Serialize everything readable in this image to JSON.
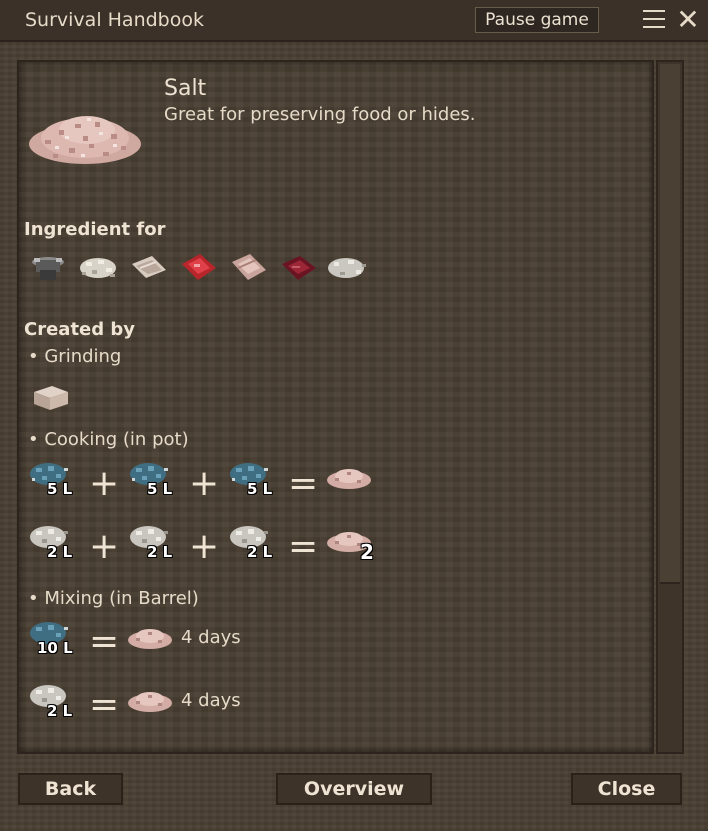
{
  "window": {
    "title": "Survival Handbook",
    "pause_label": "Pause game"
  },
  "item": {
    "name": "Salt",
    "description": "Great for preserving food or hides."
  },
  "ingredient_for": {
    "heading": "Ingredient for",
    "icons": [
      "horn-icon",
      "bone-pile-icon",
      "fish-fillet-icon",
      "raw-meat-icon",
      "pink-meat-icon",
      "red-meat-icon",
      "bone-flakes-icon"
    ]
  },
  "created_by": {
    "heading": "Created by",
    "grinding": {
      "label": "• Grinding",
      "icon": "salt-block-icon"
    },
    "cooking": {
      "label": "• Cooking (in pot)",
      "recipes": [
        {
          "inputs": [
            "5 L",
            "5 L",
            "5 L"
          ],
          "input_icon": "blue-liquid-icon",
          "plus": "+",
          "equals": "=",
          "output_qty": ""
        },
        {
          "inputs": [
            "2 L",
            "2 L",
            "2 L"
          ],
          "input_icon": "white-liquid-icon",
          "plus": "+",
          "equals": "=",
          "output_qty": "2"
        }
      ]
    },
    "mixing": {
      "label": "• Mixing (in Barrel)",
      "recipes": [
        {
          "input": "10 L",
          "input_icon": "blue-liquid-icon",
          "equals": "=",
          "duration": "4 days"
        },
        {
          "input": "2 L",
          "input_icon": "white-liquid-icon",
          "equals": "=",
          "duration": "4 days"
        }
      ]
    }
  },
  "footer": {
    "back": "Back",
    "overview": "Overview",
    "close": "Close"
  },
  "colors": {
    "panel": "#4a3f33",
    "titlebar": "#3b3128",
    "text": "#e6dac8",
    "salt": "#d8b3ab"
  }
}
